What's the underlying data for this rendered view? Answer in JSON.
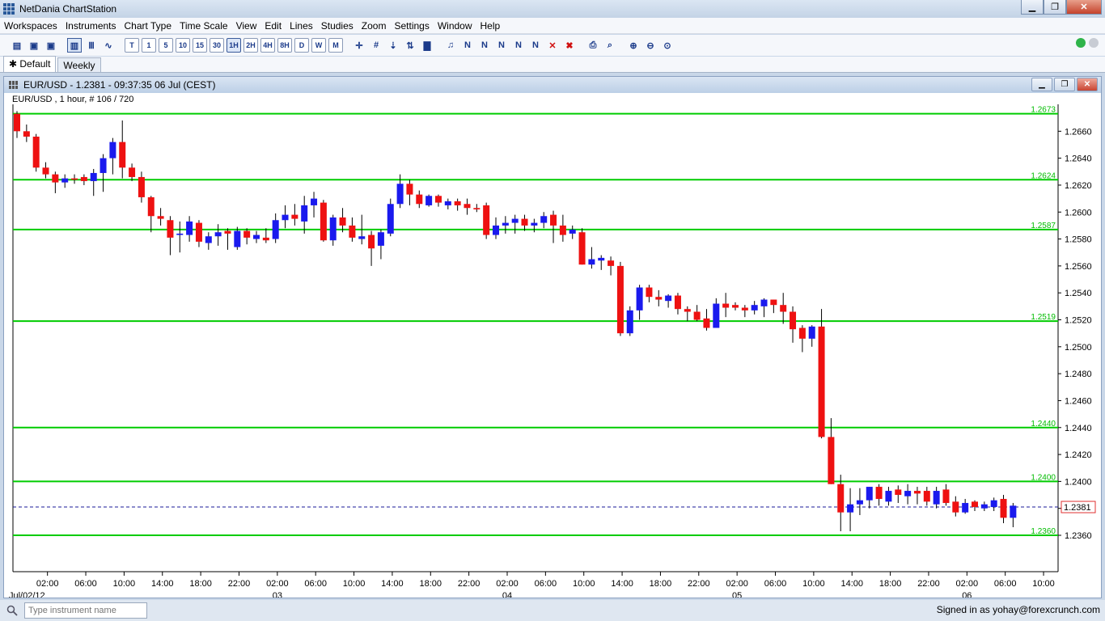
{
  "app": {
    "title": "NetDania ChartStation",
    "minimize": "▁",
    "restore": "❐",
    "close": "✕"
  },
  "menu": [
    "Workspaces",
    "Instruments",
    "Chart Type",
    "Time Scale",
    "View",
    "Edit",
    "Lines",
    "Studies",
    "Zoom",
    "Settings",
    "Window",
    "Help"
  ],
  "toolbar": {
    "timeframes": [
      "T",
      "1",
      "5",
      "10",
      "15",
      "30",
      "1H",
      "2H",
      "4H",
      "8H",
      "D",
      "W",
      "M"
    ],
    "active_timeframe": "1H"
  },
  "workspace_tabs": [
    {
      "label": "Default",
      "active": true
    },
    {
      "label": "Weekly",
      "active": false
    }
  ],
  "chart_window": {
    "title": "EUR/USD - 1.2381 - 09:37:35  06 Jul (CEST)",
    "info": "EUR/USD , 1 hour, # 106 / 720"
  },
  "chart_data": {
    "type": "candlestick",
    "instrument": "EUR/USD",
    "interval": "1 hour",
    "ylim": [
      1.2345,
      1.268
    ],
    "yticks": [
      "1.2660",
      "1.2640",
      "1.2620",
      "1.2600",
      "1.2580",
      "1.2560",
      "1.2540",
      "1.2520",
      "1.2500",
      "1.2480",
      "1.2460",
      "1.2440",
      "1.2420",
      "1.2400",
      "1.2380",
      "1.2360"
    ],
    "xticks": [
      "02:00",
      "06:00",
      "10:00",
      "14:00",
      "18:00",
      "22:00",
      "02:00",
      "06:00",
      "10:00",
      "14:00",
      "18:00",
      "22:00",
      "02:00",
      "06:00",
      "10:00",
      "14:00",
      "18:00",
      "22:00",
      "02:00",
      "06:00",
      "10:00",
      "14:00",
      "18:00",
      "22:00",
      "02:00",
      "06:00",
      "10:00"
    ],
    "date_labels": [
      "Jul/02/12",
      "03",
      "04",
      "05",
      "06"
    ],
    "horizontal_lines": [
      {
        "value": 1.2673,
        "label": "1.2673"
      },
      {
        "value": 1.2624,
        "label": "1.2624"
      },
      {
        "value": 1.2587,
        "label": "1.2587"
      },
      {
        "value": 1.2519,
        "label": "1.2519"
      },
      {
        "value": 1.244,
        "label": "1.2440"
      },
      {
        "value": 1.24,
        "label": "1.2400"
      },
      {
        "value": 1.236,
        "label": "1.2360"
      }
    ],
    "current_price": {
      "value": 1.2381,
      "label": "1.2381"
    },
    "colors": {
      "up": "#1a1aee",
      "down": "#ee1111",
      "level": "#00cc00",
      "current": "#1a1a9a"
    },
    "candles": [
      [
        1.2673,
        1.2675,
        1.2655,
        1.266
      ],
      [
        1.266,
        1.2665,
        1.2652,
        1.2656
      ],
      [
        1.2656,
        1.2658,
        1.263,
        1.2633
      ],
      [
        1.2633,
        1.2637,
        1.2625,
        1.2628
      ],
      [
        1.2628,
        1.263,
        1.2614,
        1.2622
      ],
      [
        1.2622,
        1.2628,
        1.2618,
        1.2625
      ],
      [
        1.2625,
        1.2628,
        1.2621,
        1.2624
      ],
      [
        1.2626,
        1.2628,
        1.262,
        1.2623
      ],
      [
        1.2623,
        1.2632,
        1.2612,
        1.2629
      ],
      [
        1.2629,
        1.2643,
        1.2615,
        1.264
      ],
      [
        1.264,
        1.2655,
        1.2628,
        1.2652
      ],
      [
        1.2652,
        1.2668,
        1.2625,
        1.2633
      ],
      [
        1.2633,
        1.2636,
        1.2623,
        1.2626
      ],
      [
        1.2626,
        1.263,
        1.2607,
        1.2611
      ],
      [
        1.2611,
        1.2612,
        1.2585,
        1.2597
      ],
      [
        1.2597,
        1.2603,
        1.259,
        1.2595
      ],
      [
        1.2594,
        1.2597,
        1.2568,
        1.2581
      ],
      [
        1.2583,
        1.2593,
        1.257,
        1.2584
      ],
      [
        1.2583,
        1.2597,
        1.2578,
        1.2593
      ],
      [
        1.2592,
        1.2594,
        1.2574,
        1.2578
      ],
      [
        1.2577,
        1.2585,
        1.2572,
        1.2582
      ],
      [
        1.2582,
        1.2591,
        1.2575,
        1.2585
      ],
      [
        1.2586,
        1.2588,
        1.2572,
        1.2584
      ],
      [
        1.2574,
        1.2589,
        1.2572,
        1.2586
      ],
      [
        1.2586,
        1.2588,
        1.2576,
        1.2581
      ],
      [
        1.258,
        1.2586,
        1.2577,
        1.2583
      ],
      [
        1.2581,
        1.2588,
        1.2577,
        1.2579
      ],
      [
        1.258,
        1.2599,
        1.2577,
        1.2594
      ],
      [
        1.2594,
        1.2605,
        1.2588,
        1.2598
      ],
      [
        1.2598,
        1.2606,
        1.259,
        1.2595
      ],
      [
        1.2593,
        1.2612,
        1.2584,
        1.2605
      ],
      [
        1.2605,
        1.2615,
        1.2596,
        1.261
      ],
      [
        1.2607,
        1.2609,
        1.2578,
        1.2579
      ],
      [
        1.2579,
        1.2598,
        1.2575,
        1.2596
      ],
      [
        1.2596,
        1.2603,
        1.2585,
        1.259
      ],
      [
        1.259,
        1.2596,
        1.2578,
        1.2581
      ],
      [
        1.258,
        1.2598,
        1.2576,
        1.2582
      ],
      [
        1.2583,
        1.2586,
        1.256,
        1.2573
      ],
      [
        1.2575,
        1.2587,
        1.2565,
        1.2585
      ],
      [
        1.2584,
        1.261,
        1.2582,
        1.2606
      ],
      [
        1.2606,
        1.2628,
        1.2603,
        1.2621
      ],
      [
        1.2621,
        1.2624,
        1.2605,
        1.2613
      ],
      [
        1.2613,
        1.2616,
        1.2603,
        1.2606
      ],
      [
        1.2605,
        1.2613,
        1.2604,
        1.2612
      ],
      [
        1.2612,
        1.2613,
        1.2604,
        1.2607
      ],
      [
        1.2605,
        1.261,
        1.2602,
        1.2608
      ],
      [
        1.2608,
        1.261,
        1.2601,
        1.2605
      ],
      [
        1.2606,
        1.261,
        1.2598,
        1.2603
      ],
      [
        1.2603,
        1.2606,
        1.26,
        1.2602
      ],
      [
        1.2605,
        1.2607,
        1.258,
        1.2583
      ],
      [
        1.2583,
        1.2596,
        1.258,
        1.259
      ],
      [
        1.259,
        1.2597,
        1.2584,
        1.2592
      ],
      [
        1.2592,
        1.2598,
        1.2584,
        1.2595
      ],
      [
        1.2595,
        1.2598,
        1.2586,
        1.259
      ],
      [
        1.259,
        1.2595,
        1.2585,
        1.2592
      ],
      [
        1.2592,
        1.26,
        1.2588,
        1.2597
      ],
      [
        1.2598,
        1.2601,
        1.2577,
        1.259
      ],
      [
        1.259,
        1.2598,
        1.2578,
        1.2583
      ],
      [
        1.2584,
        1.259,
        1.258,
        1.2587
      ],
      [
        1.2585,
        1.2588,
        1.2561,
        1.2561
      ],
      [
        1.2561,
        1.2574,
        1.2558,
        1.2565
      ],
      [
        1.2564,
        1.2568,
        1.2557,
        1.2566
      ],
      [
        1.2564,
        1.2567,
        1.2553,
        1.256
      ],
      [
        1.256,
        1.2563,
        1.2508,
        1.251
      ],
      [
        1.251,
        1.253,
        1.2508,
        1.2527
      ],
      [
        1.2527,
        1.2546,
        1.252,
        1.2544
      ],
      [
        1.2544,
        1.2546,
        1.2533,
        1.2537
      ],
      [
        1.2537,
        1.2542,
        1.253,
        1.2535
      ],
      [
        1.2534,
        1.2539,
        1.2529,
        1.2538
      ],
      [
        1.2538,
        1.254,
        1.2524,
        1.2528
      ],
      [
        1.2528,
        1.253,
        1.2519,
        1.2526
      ],
      [
        1.2526,
        1.2531,
        1.2519,
        1.252
      ],
      [
        1.2521,
        1.2528,
        1.2512,
        1.2514
      ],
      [
        1.2514,
        1.2536,
        1.2514,
        1.2532
      ],
      [
        1.2532,
        1.254,
        1.2522,
        1.2529
      ],
      [
        1.2531,
        1.2533,
        1.2527,
        1.2529
      ],
      [
        1.2529,
        1.2531,
        1.2522,
        1.2527
      ],
      [
        1.2527,
        1.2534,
        1.2524,
        1.2531
      ],
      [
        1.253,
        1.2536,
        1.2522,
        1.2535
      ],
      [
        1.2535,
        1.2535,
        1.2525,
        1.2531
      ],
      [
        1.2531,
        1.254,
        1.2517,
        1.2526
      ],
      [
        1.2526,
        1.253,
        1.2503,
        1.2513
      ],
      [
        1.2514,
        1.2516,
        1.2496,
        1.2506
      ],
      [
        1.2506,
        1.2516,
        1.25,
        1.2515
      ],
      [
        1.2515,
        1.2528,
        1.2432,
        1.2433
      ],
      [
        1.2433,
        1.2447,
        1.2398,
        1.2398
      ],
      [
        1.2398,
        1.2405,
        1.2363,
        1.2377
      ],
      [
        1.2377,
        1.2395,
        1.2363,
        1.2383
      ],
      [
        1.2383,
        1.2395,
        1.2375,
        1.2386
      ],
      [
        1.2386,
        1.2396,
        1.238,
        1.2396
      ],
      [
        1.2396,
        1.2398,
        1.2382,
        1.2387
      ],
      [
        1.2385,
        1.2396,
        1.2382,
        1.2393
      ],
      [
        1.2394,
        1.2397,
        1.2384,
        1.239
      ],
      [
        1.2389,
        1.2398,
        1.2383,
        1.2393
      ],
      [
        1.2393,
        1.2396,
        1.2383,
        1.2391
      ],
      [
        1.2393,
        1.2396,
        1.2382,
        1.2385
      ],
      [
        1.2383,
        1.2396,
        1.238,
        1.2393
      ],
      [
        1.2394,
        1.2398,
        1.2382,
        1.2384
      ],
      [
        1.2385,
        1.2389,
        1.2374,
        1.2377
      ],
      [
        1.2377,
        1.2387,
        1.2376,
        1.2384
      ],
      [
        1.2385,
        1.2386,
        1.2378,
        1.2381
      ],
      [
        1.238,
        1.2385,
        1.2378,
        1.2383
      ],
      [
        1.2381,
        1.2388,
        1.2378,
        1.2386
      ],
      [
        1.2387,
        1.239,
        1.2369,
        1.2373
      ],
      [
        1.2373,
        1.2384,
        1.2366,
        1.2382
      ]
    ]
  },
  "bottom": {
    "search_placeholder": "Type instrument name",
    "signed_in": "Signed in as yohay@forexcrunch.com"
  }
}
